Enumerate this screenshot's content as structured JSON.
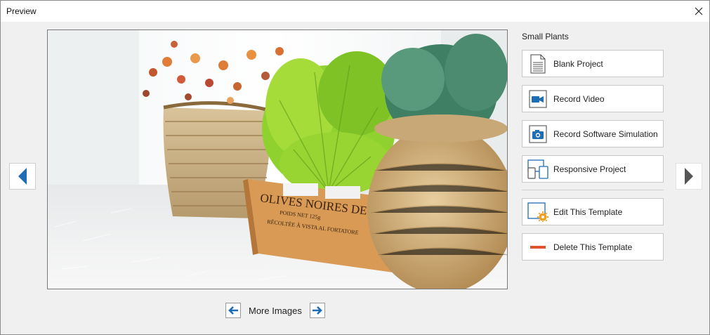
{
  "window": {
    "title": "Preview"
  },
  "template": {
    "name": "Small Plants"
  },
  "image": {
    "crate_text_line1": "OLIVES NOIRES DE NICE",
    "crate_text_line2": "POIDS NET 125g",
    "crate_text_line3": "RÉCOLTÉE À VISTA AL FORTATORE"
  },
  "actions": [
    {
      "label": "Blank Project",
      "icon": "document-icon"
    },
    {
      "label": "Record Video",
      "icon": "video-camera-icon"
    },
    {
      "label": "Record Software Simulation",
      "icon": "camera-icon"
    },
    {
      "label": "Responsive Project",
      "icon": "responsive-devices-icon"
    }
  ],
  "template_actions": [
    {
      "label": "Edit This Template",
      "icon": "edit-template-icon"
    },
    {
      "label": "Delete This Template",
      "icon": "minus-icon",
      "accent": "#e0532e"
    }
  ],
  "more_images": {
    "label": "More Images"
  },
  "colors": {
    "accent_blue": "#1f6db5",
    "delete_red": "#e0532e",
    "edit_gear": "#f0a020"
  }
}
